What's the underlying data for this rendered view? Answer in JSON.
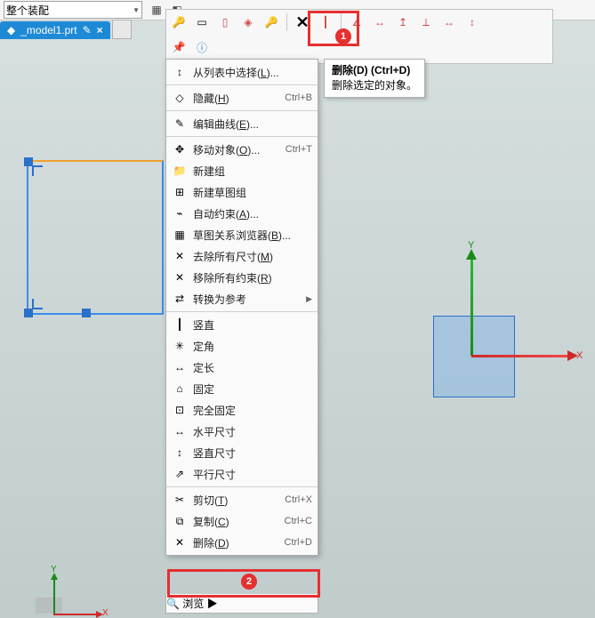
{
  "combo_text": "整个装配",
  "tab_label": "_model1.prt",
  "tab_icon_glyph": "✎",
  "tab_close_glyph": "×",
  "callout1_num": "1",
  "callout2_num": "2",
  "tooltip": {
    "title": "删除(D)  (Ctrl+D)",
    "body": "删除选定的对象。"
  },
  "axis": {
    "X": "X",
    "Y": "Y"
  },
  "menu": [
    {
      "type": "item",
      "icon": "↕",
      "label_html": "从列表中选择(<u>L</u>)...",
      "shortcut": "",
      "sub": false,
      "name": "select-from-list"
    },
    {
      "type": "sep"
    },
    {
      "type": "item",
      "icon": "◇",
      "label_html": "隐藏(<u>H</u>)",
      "shortcut": "Ctrl+B",
      "sub": false,
      "name": "hide"
    },
    {
      "type": "sep"
    },
    {
      "type": "item",
      "icon": "✎",
      "label_html": "编辑曲线(<u>E</u>)...",
      "shortcut": "",
      "sub": false,
      "name": "edit-curve"
    },
    {
      "type": "sep"
    },
    {
      "type": "item",
      "icon": "✥",
      "label_html": "移动对象(<u>O</u>)...",
      "shortcut": "Ctrl+T",
      "sub": false,
      "name": "move-object"
    },
    {
      "type": "item",
      "icon": "📁",
      "label_html": "新建组",
      "shortcut": "",
      "sub": false,
      "name": "new-group"
    },
    {
      "type": "item",
      "icon": "⊞",
      "label_html": "新建草图组",
      "shortcut": "",
      "sub": false,
      "name": "new-sketch-group"
    },
    {
      "type": "item",
      "icon": "⌁",
      "label_html": "自动约束(<u>A</u>)...",
      "shortcut": "",
      "sub": false,
      "name": "auto-constraint"
    },
    {
      "type": "item",
      "icon": "▦",
      "label_html": "草图关系浏览器(<u>B</u>)...",
      "shortcut": "",
      "sub": false,
      "name": "relation-browser"
    },
    {
      "type": "item",
      "icon": "✕",
      "label_html": "去除所有尺寸(<u>M</u>)",
      "shortcut": "",
      "sub": false,
      "name": "remove-all-dims"
    },
    {
      "type": "item",
      "icon": "✕",
      "label_html": "移除所有约束(<u>R</u>)",
      "shortcut": "",
      "sub": false,
      "name": "remove-all-constraints"
    },
    {
      "type": "item",
      "icon": "⇄",
      "label_html": "转换为参考",
      "shortcut": "",
      "sub": true,
      "name": "convert-to-reference"
    },
    {
      "type": "sep"
    },
    {
      "type": "item",
      "icon": "┃",
      "label_html": "竖直",
      "shortcut": "",
      "sub": false,
      "name": "vertical"
    },
    {
      "type": "item",
      "icon": "✳",
      "label_html": "定角",
      "shortcut": "",
      "sub": false,
      "name": "fixed-angle"
    },
    {
      "type": "item",
      "icon": "↔",
      "label_html": "定长",
      "shortcut": "",
      "sub": false,
      "name": "fixed-length"
    },
    {
      "type": "item",
      "icon": "⌂",
      "label_html": "固定",
      "shortcut": "",
      "sub": false,
      "name": "fixed"
    },
    {
      "type": "item",
      "icon": "⊡",
      "label_html": "完全固定",
      "shortcut": "",
      "sub": false,
      "name": "fully-fixed"
    },
    {
      "type": "item",
      "icon": "↔",
      "label_html": "水平尺寸",
      "shortcut": "",
      "sub": false,
      "name": "horizontal-dim"
    },
    {
      "type": "item",
      "icon": "↕",
      "label_html": "竖直尺寸",
      "shortcut": "",
      "sub": false,
      "name": "vertical-dim"
    },
    {
      "type": "item",
      "icon": "⇗",
      "label_html": "平行尺寸",
      "shortcut": "",
      "sub": false,
      "name": "parallel-dim"
    },
    {
      "type": "sep"
    },
    {
      "type": "item",
      "icon": "✂",
      "label_html": "剪切(<u>T</u>)",
      "shortcut": "Ctrl+X",
      "sub": false,
      "name": "cut"
    },
    {
      "type": "item",
      "icon": "⧉",
      "label_html": "复制(<u>C</u>)",
      "shortcut": "Ctrl+C",
      "sub": false,
      "name": "copy"
    },
    {
      "type": "item",
      "icon": "✕",
      "label_html": "删除(<u>D</u>)",
      "shortcut": "Ctrl+D",
      "sub": false,
      "name": "delete"
    }
  ],
  "browse": {
    "icon": "🔍",
    "label": "浏览",
    "sub": true
  },
  "toolbar_row1": [
    {
      "name": "key-icon",
      "g": "🔑"
    },
    {
      "name": "box-icon",
      "g": "▭"
    },
    {
      "name": "vbar-icon",
      "g": "▯",
      "c": "#d04848"
    },
    {
      "name": "diamond-icon",
      "g": "◈",
      "c": "#d04848"
    },
    {
      "name": "keys-icon",
      "g": "🔑"
    },
    {
      "name": "sep"
    },
    {
      "name": "delete-icon",
      "g": "✕",
      "hl": true
    },
    {
      "name": "handle-icon",
      "g": "┃",
      "c": "#d04848"
    },
    {
      "name": "sep"
    },
    {
      "name": "angle-icon",
      "g": "∠",
      "c": "#d04848"
    },
    {
      "name": "harrow-icon",
      "g": "↔",
      "c": "#d04848"
    },
    {
      "name": "uparrow-icon",
      "g": "↥",
      "c": "#d04848"
    },
    {
      "name": "perp-icon",
      "g": "⟂",
      "c": "#d04848"
    },
    {
      "name": "hdim-icon",
      "g": "↔",
      "c": "#d04848"
    },
    {
      "name": "vdim-icon",
      "g": "↕",
      "c": "#d04848"
    }
  ],
  "toolbar_row2": [
    {
      "name": "pin-icon",
      "g": "📌"
    },
    {
      "name": "info-icon",
      "g": "ⓘ",
      "c": "#2a70c8"
    }
  ]
}
